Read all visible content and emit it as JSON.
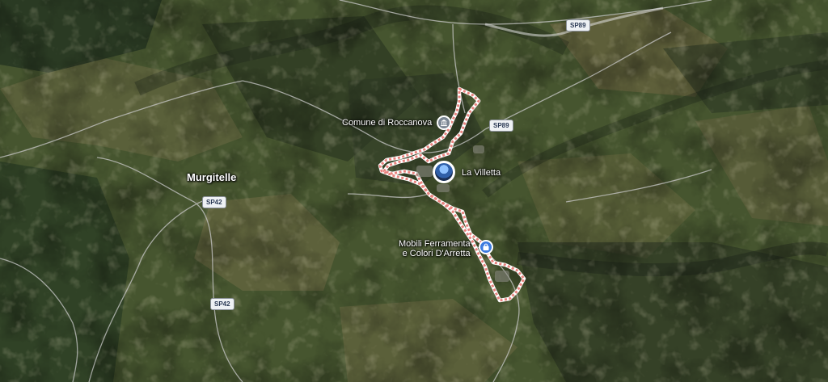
{
  "map": {
    "places": {
      "murgitelle": "Murgitelle",
      "comune": "Comune di Roccanova",
      "villetta": "La Villetta",
      "shop_line1": "Mobili Ferramenta",
      "shop_line2": "e Colori D'Arretta"
    },
    "roads": {
      "sp89_top": "SP89",
      "sp89_mid": "SP89",
      "sp42_left": "SP42",
      "sp42_bottom": "SP42"
    },
    "icons": {
      "comune": "town-hall-icon",
      "villetta": "photo-thumbnail-icon",
      "shop": "shopping-bag-icon"
    },
    "colors": {
      "boundary": "#e8837e",
      "road": "#c9c9c9",
      "shop_pin": "#3d7be0",
      "muni_pin": "#7a8592"
    }
  }
}
